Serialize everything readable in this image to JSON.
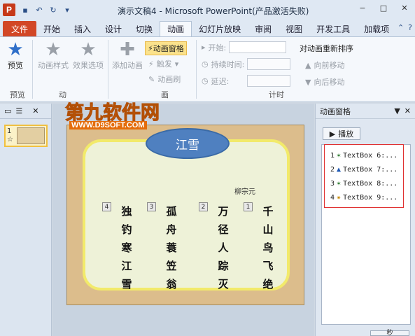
{
  "window": {
    "title": "演示文稿4 - Microsoft PowerPoint(产品激活失败)",
    "app_icon_label": "P",
    "controls": {
      "minimize": "−",
      "maximize": "□",
      "close": "✕"
    }
  },
  "tabs": [
    {
      "label": "文件"
    },
    {
      "label": "开始"
    },
    {
      "label": "插入"
    },
    {
      "label": "设计"
    },
    {
      "label": "切换"
    },
    {
      "label": "动画"
    },
    {
      "label": "幻灯片放映"
    },
    {
      "label": "审阅"
    },
    {
      "label": "视图"
    },
    {
      "label": "开发工具"
    },
    {
      "label": "加载项"
    }
  ],
  "ribbon": {
    "preview": {
      "button": "预览",
      "group": "预览"
    },
    "animation_styles": "动画样式",
    "effect_options": "效果选项",
    "group_animation_partial": "动",
    "add_animation": "添加动画",
    "animation_pane": "动画窗格",
    "trigger": "触发",
    "animation_painter": "动画刷",
    "group_advanced_partial": "画",
    "start_label": "开始:",
    "duration_label": "持续时间:",
    "delay_label": "延迟:",
    "timing_group": "计时",
    "reorder_title": "对动画重新排序",
    "move_earlier": "向前移动",
    "move_later": "向后移动"
  },
  "thumbnail": {
    "number": "1",
    "star": "☆"
  },
  "slide": {
    "title": "江雪",
    "author": "柳宗元",
    "columns": [
      {
        "tag": "4",
        "text": "独钓寒江雪"
      },
      {
        "tag": "3",
        "text": "孤舟蓑笠翁"
      },
      {
        "tag": "2",
        "text": "万径人踪灭"
      },
      {
        "tag": "1",
        "text": "千山鸟飞绝"
      }
    ]
  },
  "watermark": {
    "main": "第九软件网",
    "sub": "WWW.D9SOFT.COM"
  },
  "anim_pane": {
    "title": "动画窗格",
    "play": "播放",
    "items": [
      {
        "num": "1",
        "label": "TextBox 6:..."
      },
      {
        "num": "2",
        "label": "TextBox 7:..."
      },
      {
        "num": "3",
        "label": "TextBox 8:..."
      },
      {
        "num": "4",
        "label": "TextBox 9:..."
      }
    ],
    "bottom_label": "秒"
  }
}
